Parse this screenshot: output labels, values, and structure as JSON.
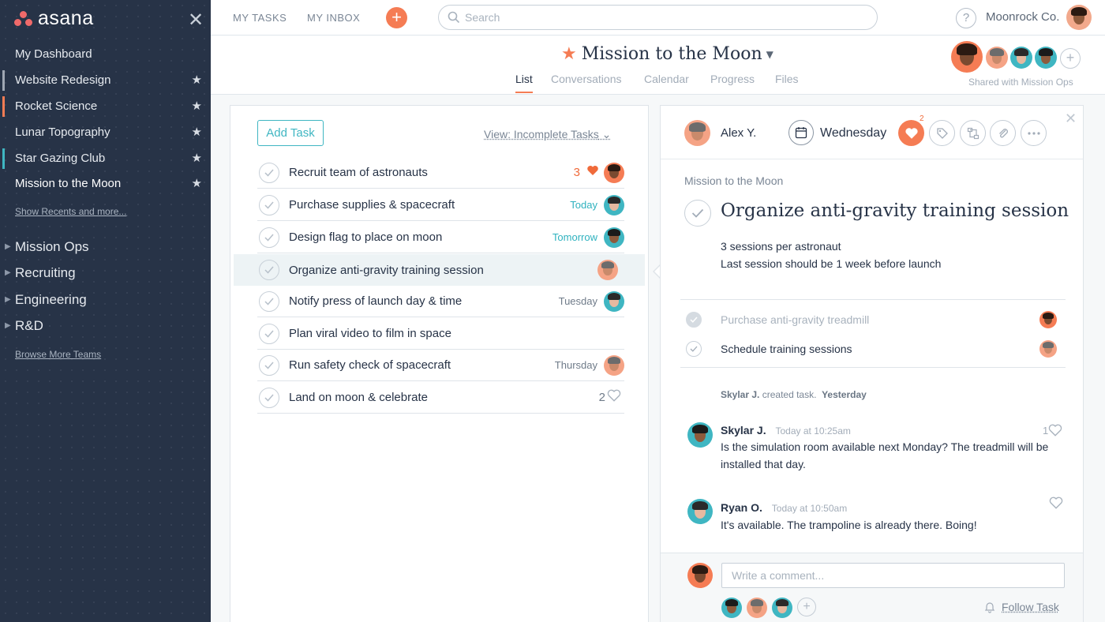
{
  "sidebar": {
    "logo_text": "asana",
    "close_icon": "close-icon",
    "items": [
      {
        "label": "My Dashboard",
        "starred": false,
        "color": ""
      },
      {
        "label": "Website Redesign",
        "starred": true,
        "color": "#9fa7b3"
      },
      {
        "label": "Rocket Science",
        "starred": true,
        "color": "#f57c54"
      },
      {
        "label": "Lunar Topography",
        "starred": true,
        "color": ""
      },
      {
        "label": "Star Gazing Club",
        "starred": true,
        "color": "#3fb6c2"
      },
      {
        "label": "Mission to the Moon",
        "starred": true,
        "color": ""
      }
    ],
    "show_recents": "Show Recents and more...",
    "teams": [
      "Mission Ops",
      "Recruiting",
      "Engineering",
      "R&D"
    ],
    "browse_teams": "Browse More Teams"
  },
  "topbar": {
    "my_tasks": "MY TASKS",
    "my_inbox": "MY INBOX",
    "search_placeholder": "Search",
    "help": "?",
    "org": "Moonrock Co."
  },
  "project": {
    "title": "Mission to the Moon",
    "tabs": [
      "List",
      "Conversations",
      "Calendar",
      "Progress",
      "Files"
    ],
    "active_tab": "List",
    "shared_with": "Shared with Mission Ops"
  },
  "task_list": {
    "add_task": "Add Task",
    "view": "View: Incomplete Tasks",
    "tasks": [
      {
        "name": "Recruit team of astronauts",
        "meta": "3",
        "meta_type": "hearts"
      },
      {
        "name": "Purchase supplies & spacecraft",
        "meta": "Today",
        "meta_type": "teal"
      },
      {
        "name": "Design flag to place on moon",
        "meta": "Tomorrow",
        "meta_type": "teal"
      },
      {
        "name": "Organize anti-gravity training session",
        "meta": "",
        "meta_type": "selected"
      },
      {
        "name": "Notify press of launch day & time",
        "meta": "Tuesday",
        "meta_type": "grey"
      },
      {
        "name": "Plan viral video to film in space",
        "meta": "",
        "meta_type": "none"
      },
      {
        "name": "Run safety check of spacecraft",
        "meta": "Thursday",
        "meta_type": "grey"
      },
      {
        "name": "Land on moon & celebrate",
        "meta": "2",
        "meta_type": "likes"
      }
    ]
  },
  "detail": {
    "assignee": "Alex Y.",
    "due": "Wednesday",
    "heart_count": "2",
    "breadcrumb": "Mission to the Moon",
    "title": "Organize anti-gravity training session",
    "description": [
      "3 sessions per astronaut",
      "Last session should be 1 week before launch"
    ],
    "subtasks": [
      {
        "name": "Purchase anti-gravity treadmill",
        "done": true
      },
      {
        "name": "Schedule training sessions",
        "done": false
      }
    ],
    "activity": {
      "who": "Skylar J.",
      "what": "created task.",
      "when": "Yesterday"
    },
    "comments": [
      {
        "author": "Skylar J.",
        "time": "Today at 10:25am",
        "text": "Is the simulation room available next Monday? The treadmill will be installed that day.",
        "likes": "1"
      },
      {
        "author": "Ryan O.",
        "time": "Today at 10:50am",
        "text": "It's available. The trampoline is already there. Boing!",
        "likes": ""
      }
    ],
    "comment_placeholder": "Write a comment...",
    "follow": "Follow Task"
  },
  "colors": {
    "accent": "#f57c54",
    "teal": "#3fb6c2",
    "sidebar": "#273347"
  }
}
